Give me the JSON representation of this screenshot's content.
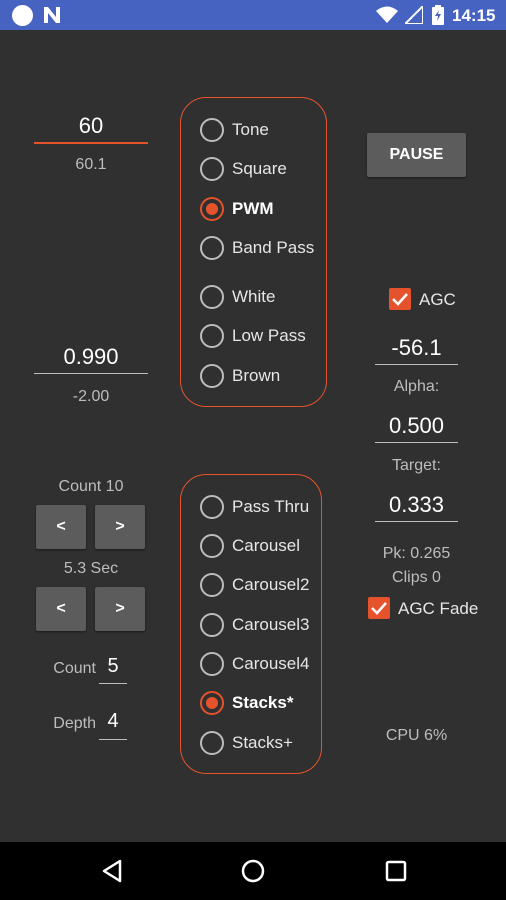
{
  "status_bar": {
    "time": "14:15",
    "icons": [
      "notification-circle-icon",
      "n-app-icon",
      "wifi-icon",
      "signal-icon",
      "battery-icon"
    ]
  },
  "left": {
    "freq_value": "60",
    "freq_sub": "60.1",
    "level_value": "0.990",
    "level_sub": "-2.00",
    "count_label": "Count 10",
    "sec_label": "5.3 Sec",
    "dec_label": "<",
    "inc_label": ">",
    "count_field_label": "Count",
    "count_field_value": "5",
    "depth_field_label": "Depth",
    "depth_field_value": "4"
  },
  "waveform_group": {
    "options": [
      {
        "label": "Tone",
        "selected": false
      },
      {
        "label": "Square",
        "selected": false
      },
      {
        "label": "PWM",
        "selected": true
      },
      {
        "label": "Band Pass",
        "selected": false
      },
      {
        "label": "White",
        "selected": false
      },
      {
        "label": "Low Pass",
        "selected": false
      },
      {
        "label": "Brown",
        "selected": false
      }
    ]
  },
  "mode_group": {
    "options": [
      {
        "label": "Pass Thru",
        "selected": false
      },
      {
        "label": "Carousel",
        "selected": false
      },
      {
        "label": "Carousel2",
        "selected": false
      },
      {
        "label": "Carousel3",
        "selected": false
      },
      {
        "label": "Carousel4",
        "selected": false
      },
      {
        "label": "Stacks*",
        "selected": true
      },
      {
        "label": "Stacks+",
        "selected": false
      }
    ]
  },
  "right": {
    "pause_label": "PAUSE",
    "agc_label": "AGC",
    "agc_checked": true,
    "agc_value": "-56.1",
    "alpha_label": "Alpha:",
    "alpha_value": "0.500",
    "target_label": "Target:",
    "target_value": "0.333",
    "pk_label": "Pk: 0.265",
    "clips_label": "Clips 0",
    "agc_fade_label": "AGC Fade",
    "agc_fade_checked": true,
    "cpu_label": "CPU 6%"
  },
  "nav_bar": {
    "icons": [
      "back-icon",
      "home-icon",
      "recents-icon"
    ]
  },
  "colors": {
    "accent": "#e5532d",
    "background": "#303030",
    "status_bar": "#4663c2",
    "button": "#5c5c5c"
  }
}
